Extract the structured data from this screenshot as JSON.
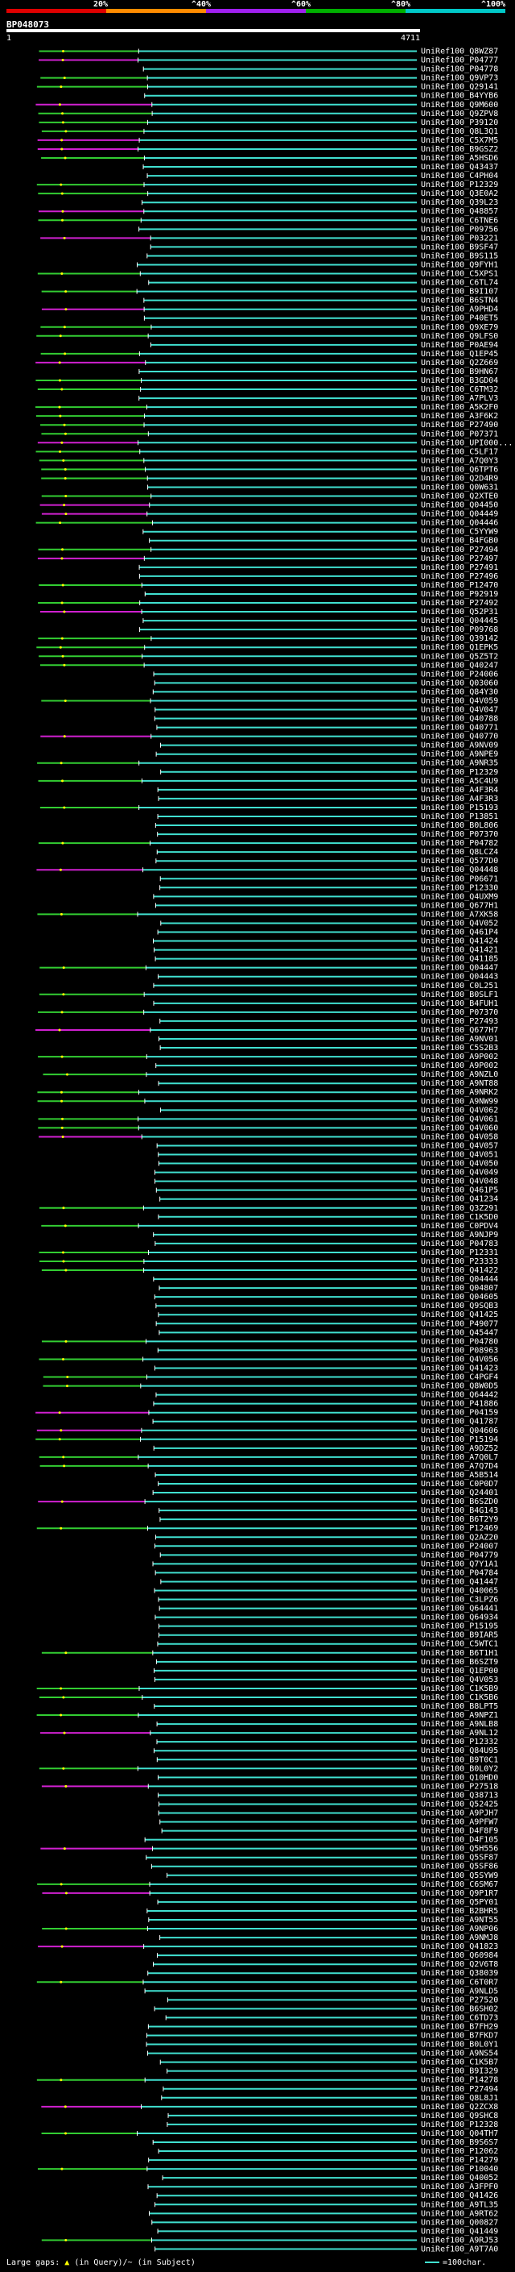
{
  "header": {
    "percent_labels": [
      "20%",
      "^40%",
      "^60%",
      "^80%",
      "^100%"
    ],
    "query_id": "BP048073",
    "start_label": "1",
    "end_label": "4711"
  },
  "colors": {
    "seg1": "#e00000",
    "seg2": "#ff8c00",
    "seg3": "#a020f0",
    "seg4": "#00b000",
    "seg5": "#00c8c8",
    "cyan": "#40e0d0",
    "green": "#32cd32",
    "magenta": "#d020d0",
    "white": "#ffffff"
  },
  "hits": [
    "UniRef100_Q8WZ87",
    "UniRef100_P04777",
    "UniRef100_P04778",
    "UniRef100_Q9VP73",
    "UniRef100_Q29141",
    "UniRef100_B4YYB6",
    "UniRef100_Q9M600",
    "UniRef100_Q9ZPV8",
    "UniRef100_P39120",
    "UniRef100_Q8L3Q1",
    "UniRef100_C5X7M5",
    "UniRef100_B9GSZ2",
    "UniRef100_A5HSD6",
    "UniRef100_Q43437",
    "UniRef100_C4PH04",
    "UniRef100_P12329",
    "UniRef100_Q3E0A2",
    "UniRef100_Q39L23",
    "UniRef100_Q48857",
    "UniRef100_C6TNE6",
    "UniRef100_P09756",
    "UniRef100_P03221",
    "UniRef100_B9SF47",
    "UniRef100_B9S115",
    "UniRef100_Q9FYH1",
    "UniRef100_C5XPS1",
    "UniRef100_C6TL74",
    "UniRef100_B9I107",
    "UniRef100_B6STN4",
    "UniRef100_A9PHD4",
    "UniRef100_P40ET5",
    "UniRef100_Q9XE79",
    "UniRef100_Q9LFS0",
    "UniRef100_P0AE94",
    "UniRef100_Q1EP45",
    "UniRef100_Q2Z669",
    "UniRef100_B9HN67",
    "UniRef100_B3GD04",
    "UniRef100_C6TM32",
    "UniRef100_A7PLV3",
    "UniRef100_A5K2F0",
    "UniRef100_A3F6K2",
    "UniRef100_P27490",
    "UniRef100_P07371",
    "UniRef100_UPI000...",
    "UniRef100_C5LF17",
    "UniRef100_A7Q0Y3",
    "UniRef100_Q6TPT6",
    "UniRef100_Q2D4R9",
    "UniRef100_Q0W631",
    "UniRef100_Q2XTE0",
    "UniRef100_Q04450",
    "UniRef100_Q04449",
    "UniRef100_Q04446",
    "UniRef100_C5YYW9",
    "UniRef100_B4FGB0",
    "UniRef100_P27494",
    "UniRef100_P27497",
    "UniRef100_P27491",
    "UniRef100_P27496",
    "UniRef100_P12470",
    "UniRef100_P92919",
    "UniRef100_P27492",
    "UniRef100_Q52P31",
    "UniRef100_Q04445",
    "UniRef100_P09768",
    "UniRef100_Q39142",
    "UniRef100_Q1EPK5",
    "UniRef100_Q5Z5T2",
    "UniRef100_Q40247",
    "UniRef100_P24006",
    "UniRef100_Q03060",
    "UniRef100_Q84Y30",
    "UniRef100_Q4V059",
    "UniRef100_Q4V047",
    "UniRef100_Q40788",
    "UniRef100_Q40771",
    "UniRef100_Q40770",
    "UniRef100_A9NV09",
    "UniRef100_A9NPE9",
    "UniRef100_A9NR35",
    "UniRef100_P12329",
    "UniRef100_A5C4U9",
    "UniRef100_A4F3R4",
    "UniRef100_A4F3R3",
    "UniRef100_P15193",
    "UniRef100_P13851",
    "UniRef100_B0L806",
    "UniRef100_P07370",
    "UniRef100_P04782",
    "UniRef100_Q8LCZ4",
    "UniRef100_Q577D0",
    "UniRef100_Q04448",
    "UniRef100_P06671",
    "UniRef100_P12330",
    "UniRef100_Q4UXM9",
    "UniRef100_Q677H1",
    "UniRef100_A7XK58",
    "UniRef100_Q4V052",
    "UniRef100_Q461P4",
    "UniRef100_Q41424",
    "UniRef100_Q41421",
    "UniRef100_Q41185",
    "UniRef100_Q04447",
    "UniRef100_Q04443",
    "UniRef100_C0L251",
    "UniRef100_B0SLF1",
    "UniRef100_B4FUH1",
    "UniRef100_P07370",
    "UniRef100_P27493",
    "UniRef100_Q677H7",
    "UniRef100_A9NV01",
    "UniRef100_C5S2B3",
    "UniRef100_A9P002",
    "UniRef100_A9P002",
    "UniRef100_A9NZL0",
    "UniRef100_A9NT88",
    "UniRef100_A9NRK2",
    "UniRef100_A9NW99",
    "UniRef100_Q4V062",
    "UniRef100_Q4V061",
    "UniRef100_Q4V060",
    "UniRef100_Q4V058",
    "UniRef100_Q4V057",
    "UniRef100_Q4V051",
    "UniRef100_Q4V050",
    "UniRef100_Q4V049",
    "UniRef100_Q4V048",
    "UniRef100_Q461P5",
    "UniRef100_Q41234",
    "UniRef100_Q3Z291",
    "UniRef100_C1K5D0",
    "UniRef100_C0PDV4",
    "UniRef100_A9NJP9",
    "UniRef100_P04783",
    "UniRef100_P12331",
    "UniRef100_P23333",
    "UniRef100_Q41422",
    "UniRef100_Q04444",
    "UniRef100_Q04807",
    "UniRef100_Q04605",
    "UniRef100_Q9SQB3",
    "UniRef100_Q41425",
    "UniRef100_P49077",
    "UniRef100_Q45447",
    "UniRef100_P04780",
    "UniRef100_P08963",
    "UniRef100_Q4V056",
    "UniRef100_Q41423",
    "UniRef100_C4PGF4",
    "UniRef100_Q8W0D5",
    "UniRef100_Q64442",
    "UniRef100_P41886",
    "UniRef100_P04159",
    "UniRef100_Q41787",
    "UniRef100_Q04606",
    "UniRef100_P15194",
    "UniRef100_A9DZ52",
    "UniRef100_A7Q0L7",
    "UniRef100_A7Q7D4",
    "UniRef100_A5B514",
    "UniRef100_C0P0D7",
    "UniRef100_Q24401",
    "UniRef100_B6SZD0",
    "UniRef100_B4G143",
    "UniRef100_B6T2Y9",
    "UniRef100_P12469",
    "UniRef100_Q2AZ20",
    "UniRef100_P24007",
    "UniRef100_P04779",
    "UniRef100_Q7Y1A1",
    "UniRef100_P04784",
    "UniRef100_Q41447",
    "UniRef100_Q40065",
    "UniRef100_C3LPZ6",
    "UniRef100_Q64441",
    "UniRef100_Q64934",
    "UniRef100_P15195",
    "UniRef100_B9IAR5",
    "UniRef100_C5WTC1",
    "UniRef100_B6T1H1",
    "UniRef100_B6SZT9",
    "UniRef100_Q1EP00",
    "UniRef100_Q4V053",
    "UniRef100_C1K5B9",
    "UniRef100_C1K5B6",
    "UniRef100_B8LPT5",
    "UniRef100_A9NPZ1",
    "UniRef100_A9NLB8",
    "UniRef100_A9NL12",
    "UniRef100_P12332",
    "UniRef100_Q84U95",
    "UniRef100_B9T0C1",
    "UniRef100_B0L0Y2",
    "UniRef100_Q10HD0",
    "UniRef100_P27518",
    "UniRef100_Q38713",
    "UniRef100_Q52425",
    "UniRef100_A9PJH7",
    "UniRef100_A9PFW7",
    "UniRef100_D4F8F9",
    "UniRef100_D4F105",
    "UniRef100_Q5H556",
    "UniRef100_Q5SF87",
    "UniRef100_Q5SF86",
    "UniRef100_Q5SYW9",
    "UniRef100_C6SM67",
    "UniRef100_Q9P1R7",
    "UniRef100_Q5PY01",
    "UniRef100_B2BHR5",
    "UniRef100_A9NT55",
    "UniRef100_A9NP06",
    "UniRef100_A9NMJ8",
    "UniRef100_Q41823",
    "UniRef100_Q60984",
    "UniRef100_Q2V6T8",
    "UniRef100_Q38039",
    "UniRef100_C6T0R7",
    "UniRef100_A9NLD5",
    "UniRef100_P27520",
    "UniRef100_B6SH02",
    "UniRef100_C6TD73",
    "UniRef100_B7FH29",
    "UniRef100_B7FKD7",
    "UniRef100_B0L0Y1",
    "UniRef100_A9NS54",
    "UniRef100_C1K5B7",
    "UniRef100_B9I329",
    "UniRef100_P14278",
    "UniRef100_P27494",
    "UniRef100_Q8L8J1",
    "UniRef100_Q2ZCX8",
    "UniRef100_Q9SHC8",
    "UniRef100_P12328",
    "UniRef100_Q04TH7",
    "UniRef100_B9S6S7",
    "UniRef100_P12062",
    "UniRef100_P14279",
    "UniRef100_P10040",
    "UniRef100_Q40052",
    "UniRef100_A3FPF0",
    "UniRef100_Q41426",
    "UniRef100_A9TL35",
    "UniRef100_A9RT62",
    "UniRef100_Q00827",
    "UniRef100_Q41449",
    "UniRef100_A9RJ53",
    "UniRef100_A9T7A0"
  ],
  "legend": {
    "gaps_label": "Large gaps:",
    "in_query": "(in Query)/~ (in Subject)",
    "mark_symbol": "▲",
    "scale_label": "=100char."
  }
}
